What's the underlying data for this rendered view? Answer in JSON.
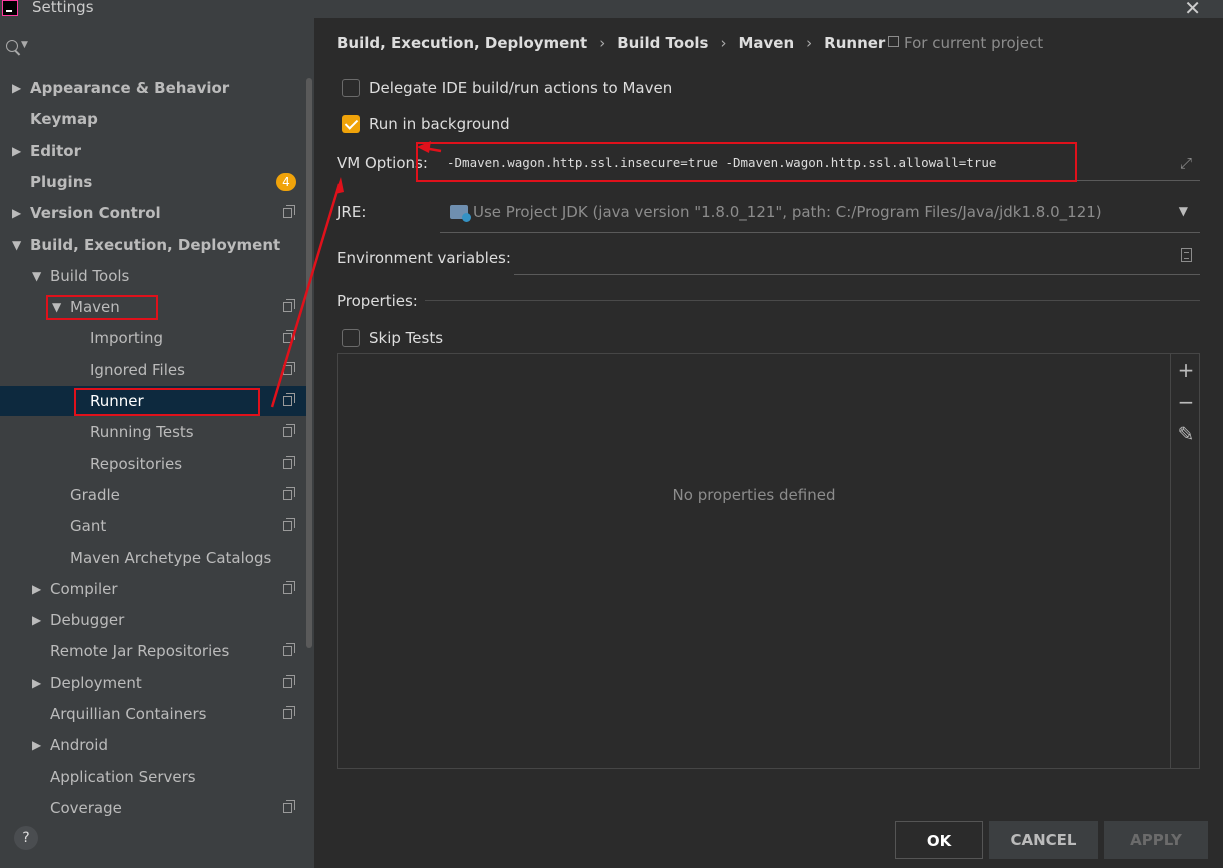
{
  "window": {
    "title": "Settings"
  },
  "sidebar": {
    "items": [
      {
        "label": "Appearance & Behavior",
        "bold": true,
        "arrow": "right",
        "level": 0
      },
      {
        "label": "Keymap",
        "bold": true,
        "level": 0
      },
      {
        "label": "Editor",
        "bold": true,
        "arrow": "right",
        "level": 0
      },
      {
        "label": "Plugins",
        "bold": true,
        "level": 0,
        "badge": "4"
      },
      {
        "label": "Version Control",
        "bold": true,
        "arrow": "right",
        "level": 0,
        "copy": true
      },
      {
        "label": "Build, Execution, Deployment",
        "bold": true,
        "arrow": "down",
        "level": 0
      },
      {
        "label": "Build Tools",
        "arrow": "down",
        "level": 1
      },
      {
        "label": "Maven",
        "arrow": "down",
        "level": 2,
        "copy": true
      },
      {
        "label": "Importing",
        "level": 3,
        "copy": true
      },
      {
        "label": "Ignored Files",
        "level": 3,
        "copy": true
      },
      {
        "label": "Runner",
        "level": 3,
        "copy": true,
        "selected": true
      },
      {
        "label": "Running Tests",
        "level": 3,
        "copy": true
      },
      {
        "label": "Repositories",
        "level": 3,
        "copy": true
      },
      {
        "label": "Gradle",
        "level": 2,
        "copy": true
      },
      {
        "label": "Gant",
        "level": 2,
        "copy": true
      },
      {
        "label": "Maven Archetype Catalogs",
        "level": 2
      },
      {
        "label": "Compiler",
        "arrow": "right",
        "level": 1,
        "copy": true
      },
      {
        "label": "Debugger",
        "arrow": "right",
        "level": 1
      },
      {
        "label": "Remote Jar Repositories",
        "level": 1,
        "copy": true
      },
      {
        "label": "Deployment",
        "arrow": "right",
        "level": 1,
        "copy": true
      },
      {
        "label": "Arquillian Containers",
        "level": 1,
        "copy": true
      },
      {
        "label": "Android",
        "arrow": "right",
        "level": 1
      },
      {
        "label": "Application Servers",
        "level": 1
      },
      {
        "label": "Coverage",
        "level": 1,
        "copy": true
      }
    ]
  },
  "breadcrumb": {
    "items": [
      "Build, Execution, Deployment",
      "Build Tools",
      "Maven",
      "Runner"
    ],
    "scope": "For current project"
  },
  "options": {
    "delegate_label": "Delegate IDE build/run actions to Maven",
    "delegate_checked": false,
    "background_label": "Run in background",
    "background_checked": true,
    "vm_label": "VM Options:",
    "vm_value": "-Dmaven.wagon.http.ssl.insecure=true -Dmaven.wagon.http.ssl.allowall=true",
    "jre_label": "JRE:",
    "jre_value": "Use Project JDK (java version \"1.8.0_121\", path: C:/Program Files/Java/jdk1.8.0_121)",
    "env_label": "Environment variables:",
    "env_value": "",
    "properties_label": "Properties:",
    "skip_tests_label": "Skip Tests",
    "skip_tests_checked": false
  },
  "properties_table": {
    "empty_text": "No properties defined",
    "tools": [
      "+",
      "−",
      "✎"
    ]
  },
  "buttons": {
    "ok": "OK",
    "cancel": "CANCEL",
    "apply": "APPLY",
    "help": "?"
  },
  "colors": {
    "accent": "#f0a30a",
    "annotation": "#e0111b",
    "selection": "#0d293e"
  }
}
